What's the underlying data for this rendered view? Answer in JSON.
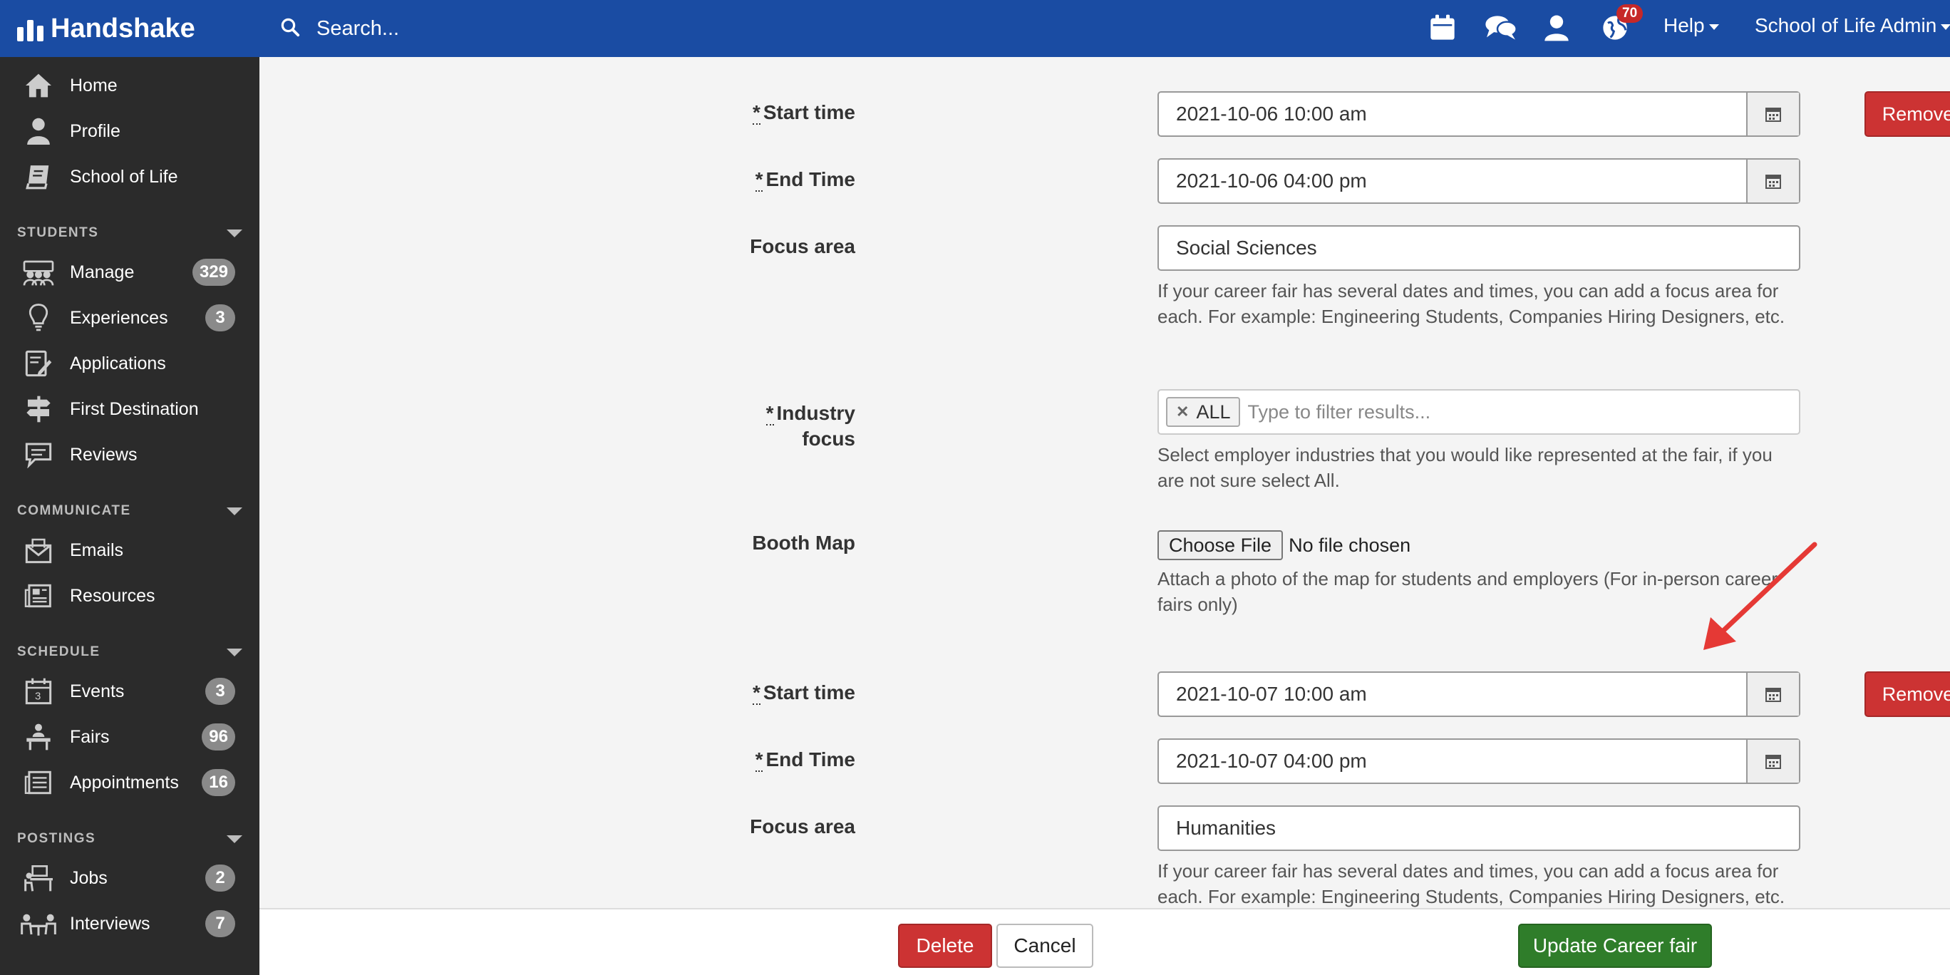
{
  "header": {
    "logo_text": "Handshake",
    "search_placeholder": "Search...",
    "notifications_count": "70",
    "help_label": "Help",
    "account_label": "School of Life Admin"
  },
  "sidebar": {
    "top_items": [
      {
        "label": "Home",
        "icon": "home-icon"
      },
      {
        "label": "Profile",
        "icon": "user-icon"
      },
      {
        "label": "School of Life",
        "icon": "book-icon"
      }
    ],
    "sections": {
      "students": {
        "title": "STUDENTS",
        "items": [
          {
            "label": "Manage",
            "count": "329",
            "icon": "students-icon"
          },
          {
            "label": "Experiences",
            "count": "3",
            "icon": "lightbulb-icon"
          },
          {
            "label": "Applications",
            "icon": "document-edit-icon"
          },
          {
            "label": "First Destination",
            "icon": "signpost-icon"
          },
          {
            "label": "Reviews",
            "icon": "comment-icon"
          }
        ]
      },
      "communicate": {
        "title": "COMMUNICATE",
        "items": [
          {
            "label": "Emails",
            "icon": "envelope-icon"
          },
          {
            "label": "Resources",
            "icon": "newspaper-icon"
          }
        ]
      },
      "schedule": {
        "title": "SCHEDULE",
        "items": [
          {
            "label": "Events",
            "count": "3",
            "icon": "calendar-icon"
          },
          {
            "label": "Fairs",
            "count": "96",
            "icon": "booth-icon"
          },
          {
            "label": "Appointments",
            "count": "16",
            "icon": "appointment-icon"
          }
        ]
      },
      "postings": {
        "title": "POSTINGS",
        "items": [
          {
            "label": "Jobs",
            "count": "2",
            "icon": "desk-icon"
          },
          {
            "label": "Interviews",
            "count": "7",
            "icon": "interview-icon"
          }
        ]
      }
    }
  },
  "form": {
    "required_mark": "*",
    "sessions": [
      {
        "start_label": "Start time",
        "start_value": "2021-10-06 10:00 am",
        "end_label": "End Time",
        "end_value": "2021-10-06 04:00 pm",
        "focus_label": "Focus area",
        "focus_value": "Social Sciences",
        "focus_help": "If your career fair has several dates and times, you can add a focus area for each. For example: Engineering Students, Companies Hiring Designers, etc.",
        "industry_label": "Industry focus",
        "industry_tag": "ALL",
        "industry_placeholder": "Type to filter results...",
        "industry_help": "Select employer industries that you would like represented at the fair, if you are not sure select All.",
        "booth_label": "Booth Map",
        "booth_button": "Choose File",
        "booth_status": "No file chosen",
        "booth_help": "Attach a photo of the map for students and employers (For in-person career fairs only)",
        "remove_label": "Remove"
      },
      {
        "start_label": "Start time",
        "start_value": "2021-10-07 10:00 am",
        "end_label": "End Time",
        "end_value": "2021-10-07 04:00 pm",
        "focus_label": "Focus area",
        "focus_value": "Humanities",
        "focus_help": "If your career fair has several dates and times, you can add a focus area for each. For example: Engineering Students, Companies Hiring Designers, etc.",
        "remove_label": "Remove"
      }
    ]
  },
  "footer": {
    "delete_label": "Delete",
    "cancel_label": "Cancel",
    "update_label": "Update Career fair"
  },
  "colors": {
    "header_bg": "#1a4ca3",
    "sidebar_bg": "#2b2b2b",
    "danger": "#cc3333",
    "success": "#2f7d2a",
    "annotation_arrow": "#e53935"
  }
}
